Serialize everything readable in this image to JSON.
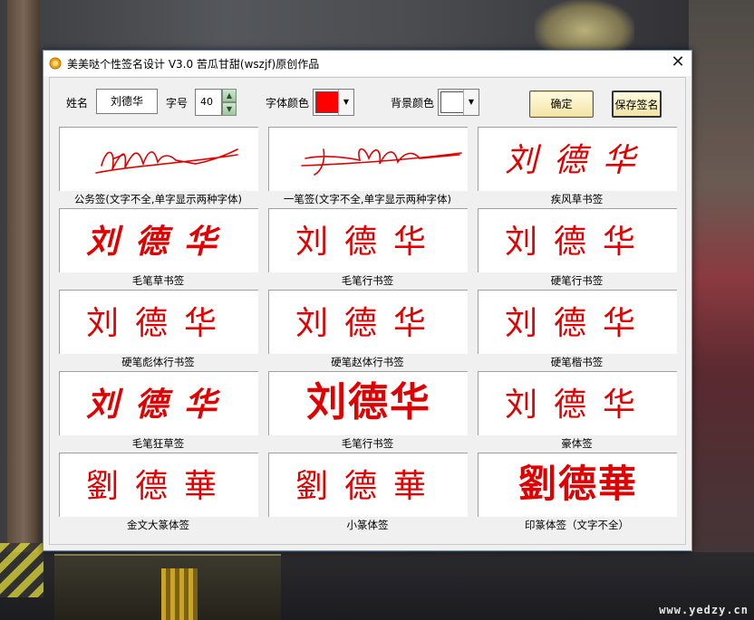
{
  "window": {
    "title": "美美哒个性签名设计 V3.0    苦瓜甘甜(wszjf)原创作品",
    "close_glyph": "✕"
  },
  "toolbar": {
    "name_label": "姓名",
    "name_value": "刘德华",
    "size_label": "字号",
    "size_value": "40",
    "font_color_label": "字体颜色",
    "font_color": "#ff0000",
    "bg_color_label": "背景颜色",
    "bg_color": "#ffffff",
    "ok_label": "确定",
    "save_label": "保存签名"
  },
  "signature_color": "#e00000",
  "signatures": [
    {
      "caption": "公务签(文字不全,单字显示两种字体)"
    },
    {
      "caption": "一笔签(文字不全,单字显示两种字体)"
    },
    {
      "caption": "疾风草书签",
      "sample": "刘德华"
    },
    {
      "caption": "毛笔草书签",
      "sample": "刘德华"
    },
    {
      "caption": "毛笔行书签",
      "sample": "刘德华"
    },
    {
      "caption": "硬笔行书签",
      "sample": "刘德华"
    },
    {
      "caption": "硬笔彪体行书签",
      "sample": "刘德华"
    },
    {
      "caption": "硬笔赵体行书签",
      "sample": "刘德华"
    },
    {
      "caption": "硬笔楷书签",
      "sample": "刘德华"
    },
    {
      "caption": "毛笔狂草签",
      "sample": "刘德华"
    },
    {
      "caption": "毛笔行书签",
      "sample": "刘德华"
    },
    {
      "caption": "豪体签",
      "sample": "刘德华"
    },
    {
      "caption": "金文大篆体签",
      "sample": "劉德華"
    },
    {
      "caption": "小篆体签",
      "sample": "劉德華"
    },
    {
      "caption": "印篆体签（文字不全）",
      "sample": "劉德華"
    }
  ],
  "watermark": "www.yedzy.cn"
}
